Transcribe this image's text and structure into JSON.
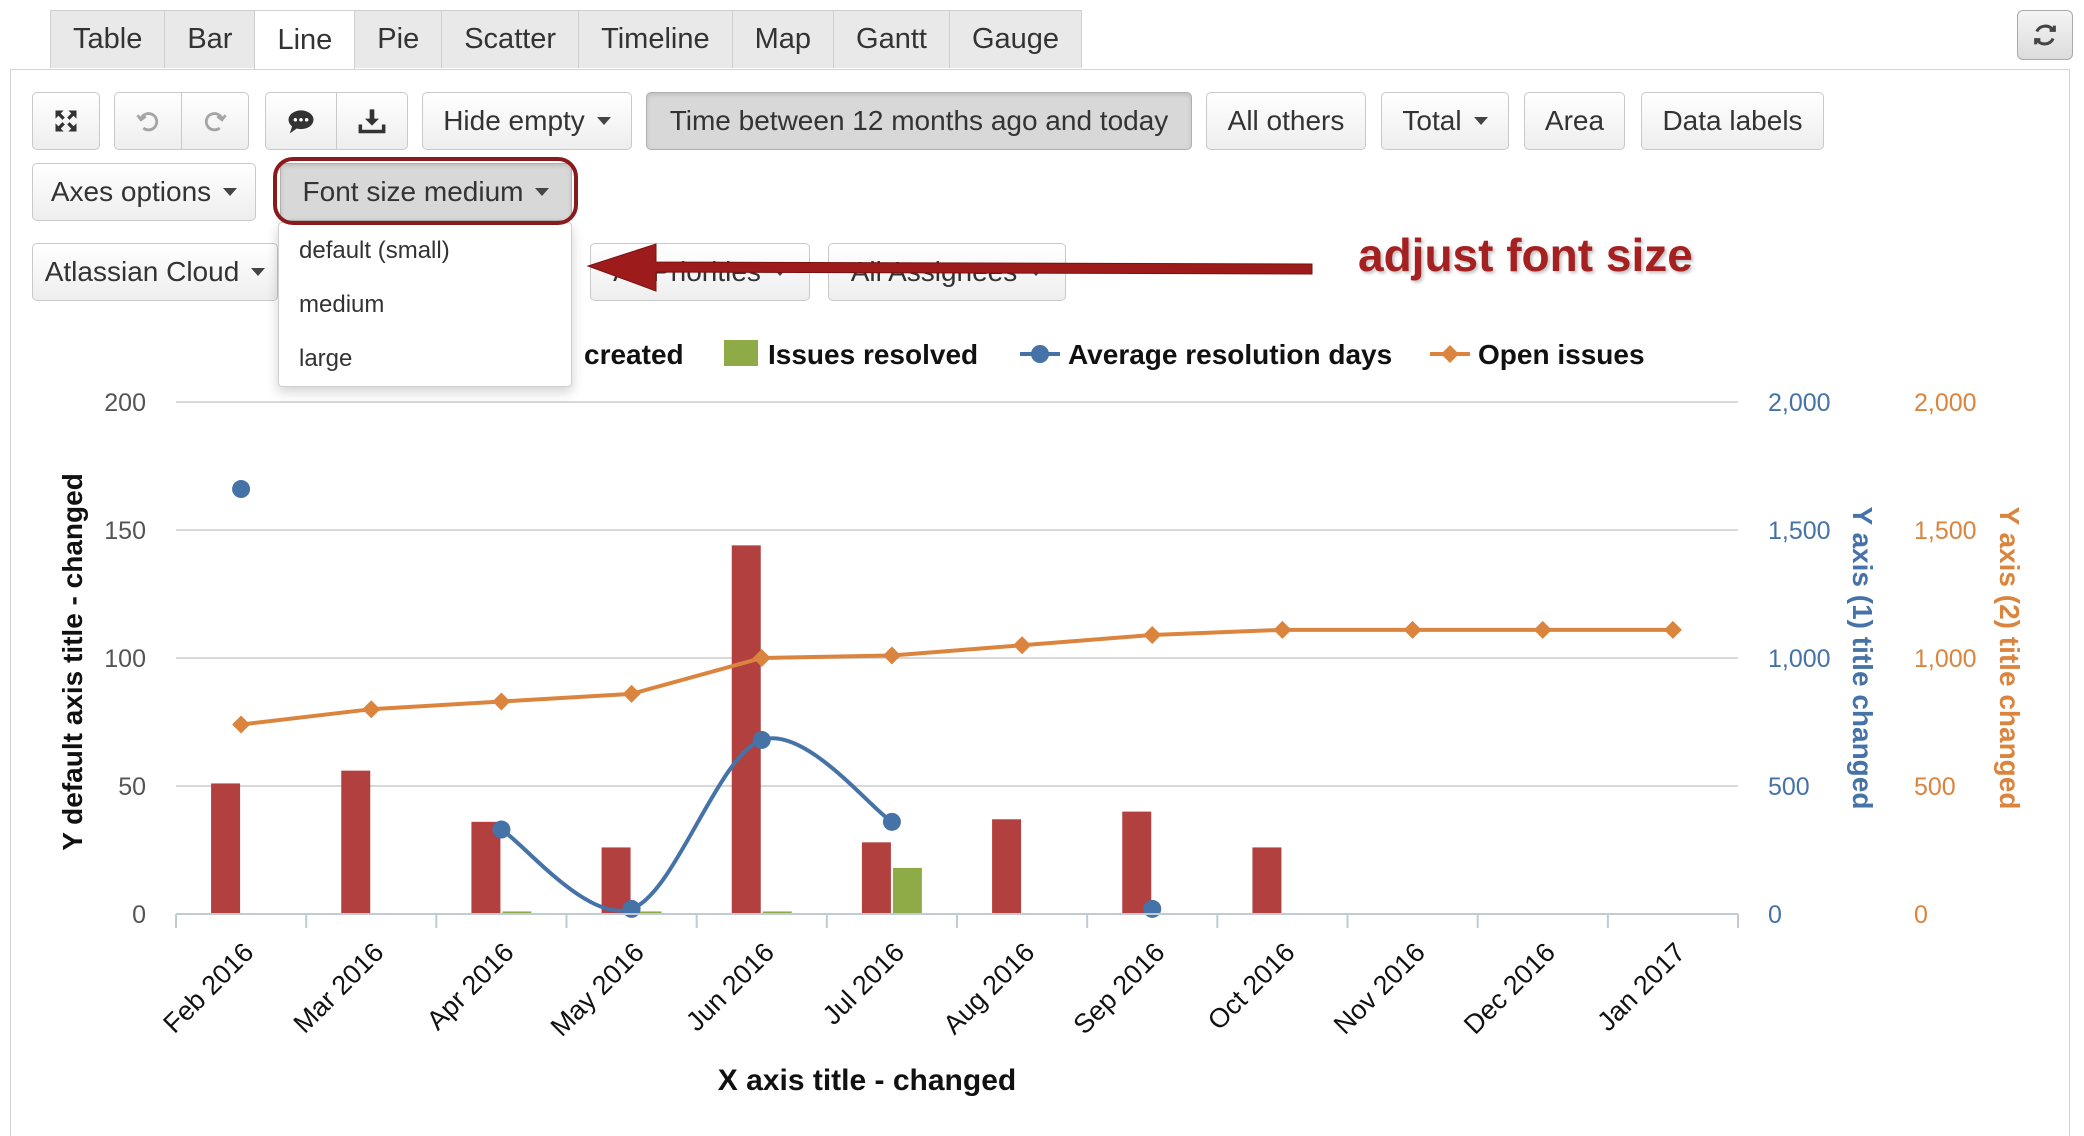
{
  "tabs": [
    "Table",
    "Bar",
    "Line",
    "Pie",
    "Scatter",
    "Timeline",
    "Map",
    "Gantt",
    "Gauge"
  ],
  "active_tab": "Line",
  "toolbar": {
    "hide_empty": "Hide empty",
    "time_filter": "Time between 12 months ago and today",
    "all_others": "All others",
    "total": "Total",
    "area": "Area",
    "data_labels": "Data labels",
    "axes_options": "Axes options",
    "font_size": "Font size medium",
    "atlassian_cloud": "Atlassian Cloud",
    "all_priorities": "All Priorities",
    "all_assignees": "All Assignees"
  },
  "font_menu": {
    "options": [
      "default (small)",
      "medium",
      "large"
    ]
  },
  "annotation": "adjust font size",
  "colors": {
    "created": "#b1403f",
    "resolved": "#8fab48",
    "avg_days": "#4572a7",
    "open": "#db843d",
    "annotation": "#a52020"
  },
  "icons": [
    "fullscreen-icon",
    "undo-icon",
    "redo-icon",
    "comment-icon",
    "download-icon",
    "refresh-icon"
  ],
  "chart_data": {
    "type": "bar",
    "categories": [
      "Feb 2016",
      "Mar 2016",
      "Apr 2016",
      "May 2016",
      "Jun 2016",
      "Jul 2016",
      "Aug 2016",
      "Sep 2016",
      "Oct 2016",
      "Nov 2016",
      "Dec 2016",
      "Jan 2017"
    ],
    "xlabel": "X axis title - changed",
    "ylabel": "Y default axis title - changed",
    "ylabel_right1": "Y axis (1) title changed",
    "ylabel_right2": "Y axis (2) title changed",
    "ylim": [
      0,
      200
    ],
    "ylim_right1": [
      0,
      2000
    ],
    "ylim_right2": [
      0,
      2000
    ],
    "yticks": [
      "0",
      "50",
      "100",
      "150",
      "200"
    ],
    "yticks_right1": [
      "0",
      "500",
      "1,000",
      "1,500",
      "2,000"
    ],
    "yticks_right2": [
      "0",
      "500",
      "1,000",
      "1,500",
      "2,000"
    ],
    "legend_position": "top",
    "grid": "horizontal",
    "series": [
      {
        "name": "created",
        "legend_label": "created",
        "type": "bar",
        "axis": "left",
        "values": [
          51,
          56,
          36,
          26,
          144,
          28,
          37,
          40,
          26,
          0,
          0,
          0
        ]
      },
      {
        "name": "Issues resolved",
        "legend_label": "Issues resolved",
        "type": "bar",
        "axis": "left",
        "values": [
          0,
          0,
          1,
          1,
          1,
          18,
          0,
          0,
          0,
          0,
          0,
          0
        ]
      },
      {
        "name": "Average resolution days",
        "legend_label": "Average resolution days",
        "type": "spline",
        "axis": "right1",
        "values": [
          1660,
          null,
          330,
          20,
          680,
          360,
          null,
          20,
          null,
          null,
          null,
          null
        ]
      },
      {
        "name": "Open issues",
        "legend_label": "Open issues",
        "type": "line",
        "axis": "right2",
        "values": [
          740,
          800,
          830,
          860,
          1000,
          1010,
          1050,
          1090,
          1110,
          1110,
          1110,
          1110
        ]
      }
    ]
  }
}
